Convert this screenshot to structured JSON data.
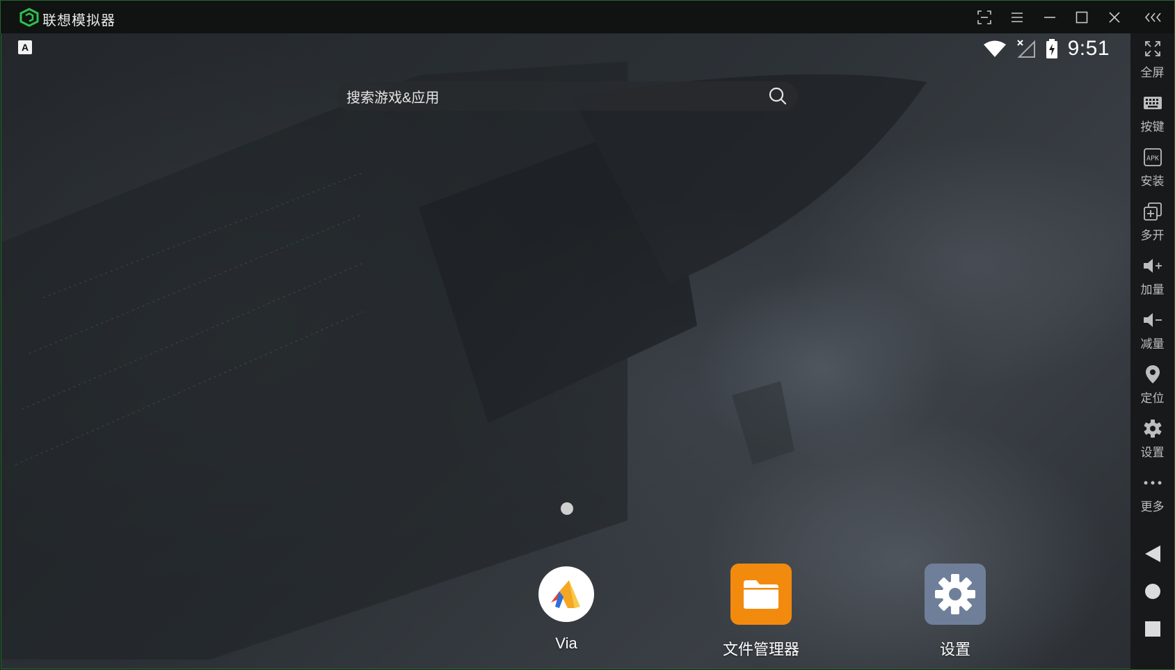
{
  "window": {
    "title": "联想模拟器",
    "controls": [
      "screenshot-icon",
      "menu-icon",
      "minimize-icon",
      "maximize-icon",
      "close-icon",
      "collapse-sidebar-icon"
    ]
  },
  "status_bar": {
    "notification_badge": "A",
    "time": "9:51"
  },
  "search": {
    "placeholder": "搜索游戏&应用"
  },
  "home": {
    "page_count": 1,
    "current_page": 1,
    "dock_apps": [
      {
        "label": "Via",
        "icon": "via-browser-icon"
      },
      {
        "label": "文件管理器",
        "icon": "folder-icon"
      },
      {
        "label": "设置",
        "icon": "gear-icon"
      }
    ]
  },
  "sidebar": {
    "items": [
      {
        "label": "全屏",
        "icon": "fullscreen-icon"
      },
      {
        "label": "按键",
        "icon": "keyboard-icon"
      },
      {
        "label": "安装",
        "icon": "apk-install-icon"
      },
      {
        "label": "多开",
        "icon": "multi-instance-icon"
      },
      {
        "label": "加量",
        "icon": "volume-up-icon"
      },
      {
        "label": "减量",
        "icon": "volume-down-icon"
      },
      {
        "label": "定位",
        "icon": "location-pin-icon"
      },
      {
        "label": "设置",
        "icon": "gear-icon"
      },
      {
        "label": "更多",
        "icon": "more-dots-icon"
      }
    ],
    "nav": [
      "back-icon",
      "home-icon",
      "recents-icon"
    ]
  },
  "colors": {
    "accent_green": "#1f6b2a",
    "files_orange": "#f28a0e",
    "settings_slate": "#6f7f99"
  }
}
